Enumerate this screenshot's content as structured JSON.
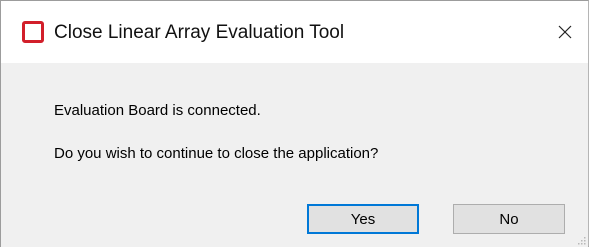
{
  "window": {
    "title": "Close Linear Array Evaluation Tool",
    "app_icon": "app-logo-icon",
    "close_icon": "close-icon",
    "accent_color": "#d21f2a"
  },
  "message": {
    "line1": "Evaluation Board is connected.",
    "line2": "Do you wish to continue to close the application?"
  },
  "buttons": {
    "yes_label": "Yes",
    "no_label": "No",
    "default_button_border": "#0078d7"
  }
}
